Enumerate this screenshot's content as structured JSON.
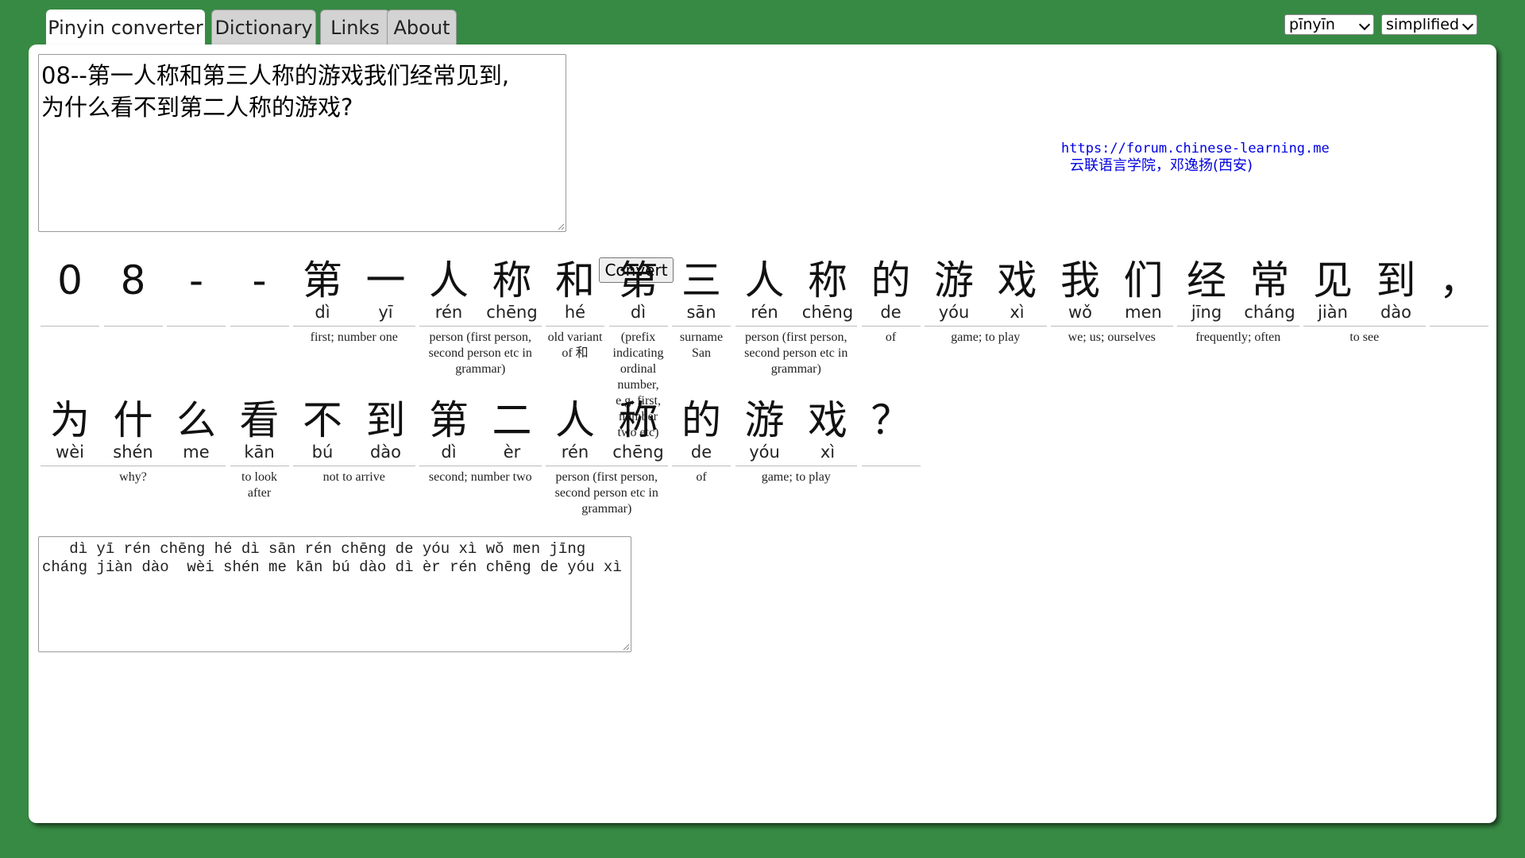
{
  "tabs": [
    {
      "label": "Pinyin converter",
      "active": true
    },
    {
      "label": "Dictionary",
      "active": false
    },
    {
      "label": "Links",
      "active": false
    },
    {
      "label": "About",
      "active": false
    }
  ],
  "selects": {
    "romanization": "pīnyīn",
    "script": "simplified"
  },
  "input": {
    "text": "08--第一人称和第三人称的游戏我们经常见到,\n为什么看不到第二人称的游戏?"
  },
  "convert_label": "Convert",
  "credit": {
    "url": "https://forum.chinese-learning.me",
    "org": "云联语言学院，邓逸扬(西安)"
  },
  "rows": [
    {
      "chars": [
        {
          "h": "0",
          "p": ""
        },
        {
          "h": "8",
          "p": ""
        },
        {
          "h": "-",
          "p": ""
        },
        {
          "h": "-",
          "p": ""
        },
        {
          "h": "第",
          "p": "dì"
        },
        {
          "h": "一",
          "p": "yī"
        },
        {
          "h": "人",
          "p": "rén"
        },
        {
          "h": "称",
          "p": "chēng"
        },
        {
          "h": "和",
          "p": "hé"
        },
        {
          "h": "第",
          "p": "dì"
        },
        {
          "h": "三",
          "p": "sān"
        },
        {
          "h": "人",
          "p": "rén"
        },
        {
          "h": "称",
          "p": "chēng"
        },
        {
          "h": "的",
          "p": "de"
        },
        {
          "h": "游",
          "p": "yóu"
        },
        {
          "h": "戏",
          "p": "xì"
        },
        {
          "h": "我",
          "p": "wǒ"
        },
        {
          "h": "们",
          "p": "men"
        },
        {
          "h": "经",
          "p": "jīng"
        },
        {
          "h": "常",
          "p": "cháng"
        },
        {
          "h": "见",
          "p": "jiàn"
        },
        {
          "h": "到",
          "p": "dào"
        },
        {
          "h": "，",
          "p": ""
        }
      ],
      "words": [
        {
          "start": 0,
          "len": 1,
          "def": ""
        },
        {
          "start": 1,
          "len": 1,
          "def": ""
        },
        {
          "start": 2,
          "len": 1,
          "def": ""
        },
        {
          "start": 3,
          "len": 1,
          "def": ""
        },
        {
          "start": 4,
          "len": 2,
          "def": "first; number one"
        },
        {
          "start": 6,
          "len": 2,
          "def": "person (first person, second person etc in grammar)"
        },
        {
          "start": 8,
          "len": 1,
          "def": "old variant of 和"
        },
        {
          "start": 9,
          "len": 1,
          "def": "(prefix indicating ordinal number, e.g. first, number two etc)"
        },
        {
          "start": 10,
          "len": 1,
          "def": "surname San"
        },
        {
          "start": 11,
          "len": 2,
          "def": "person (first person, second person etc in grammar)"
        },
        {
          "start": 13,
          "len": 1,
          "def": "of"
        },
        {
          "start": 14,
          "len": 2,
          "def": "game; to play"
        },
        {
          "start": 16,
          "len": 2,
          "def": "we; us; ourselves"
        },
        {
          "start": 18,
          "len": 2,
          "def": "frequently; often"
        },
        {
          "start": 20,
          "len": 2,
          "def": "to see"
        },
        {
          "start": 22,
          "len": 1,
          "def": ""
        }
      ]
    },
    {
      "chars": [
        {
          "h": "为",
          "p": "wèi"
        },
        {
          "h": "什",
          "p": "shén"
        },
        {
          "h": "么",
          "p": "me"
        },
        {
          "h": "看",
          "p": "kān"
        },
        {
          "h": "不",
          "p": "bú"
        },
        {
          "h": "到",
          "p": "dào"
        },
        {
          "h": "第",
          "p": "dì"
        },
        {
          "h": "二",
          "p": "èr"
        },
        {
          "h": "人",
          "p": "rén"
        },
        {
          "h": "称",
          "p": "chēng"
        },
        {
          "h": "的",
          "p": "de"
        },
        {
          "h": "游",
          "p": "yóu"
        },
        {
          "h": "戏",
          "p": "xì"
        },
        {
          "h": "？",
          "p": ""
        }
      ],
      "words": [
        {
          "start": 0,
          "len": 3,
          "def": "why?"
        },
        {
          "start": 3,
          "len": 1,
          "def": "to look after"
        },
        {
          "start": 4,
          "len": 2,
          "def": "not to arrive"
        },
        {
          "start": 6,
          "len": 2,
          "def": "second; number two"
        },
        {
          "start": 8,
          "len": 2,
          "def": "person (first person, second person etc in grammar)"
        },
        {
          "start": 10,
          "len": 1,
          "def": "of"
        },
        {
          "start": 11,
          "len": 2,
          "def": "game; to play"
        },
        {
          "start": 13,
          "len": 1,
          "def": ""
        }
      ]
    }
  ],
  "output": {
    "text": "   dì yī rén chēng hé dì sān rén chēng de yóu xì wǒ men jīng cháng jiàn dào  wèi shén me kān bú dào dì èr rén chēng de yóu xì"
  }
}
